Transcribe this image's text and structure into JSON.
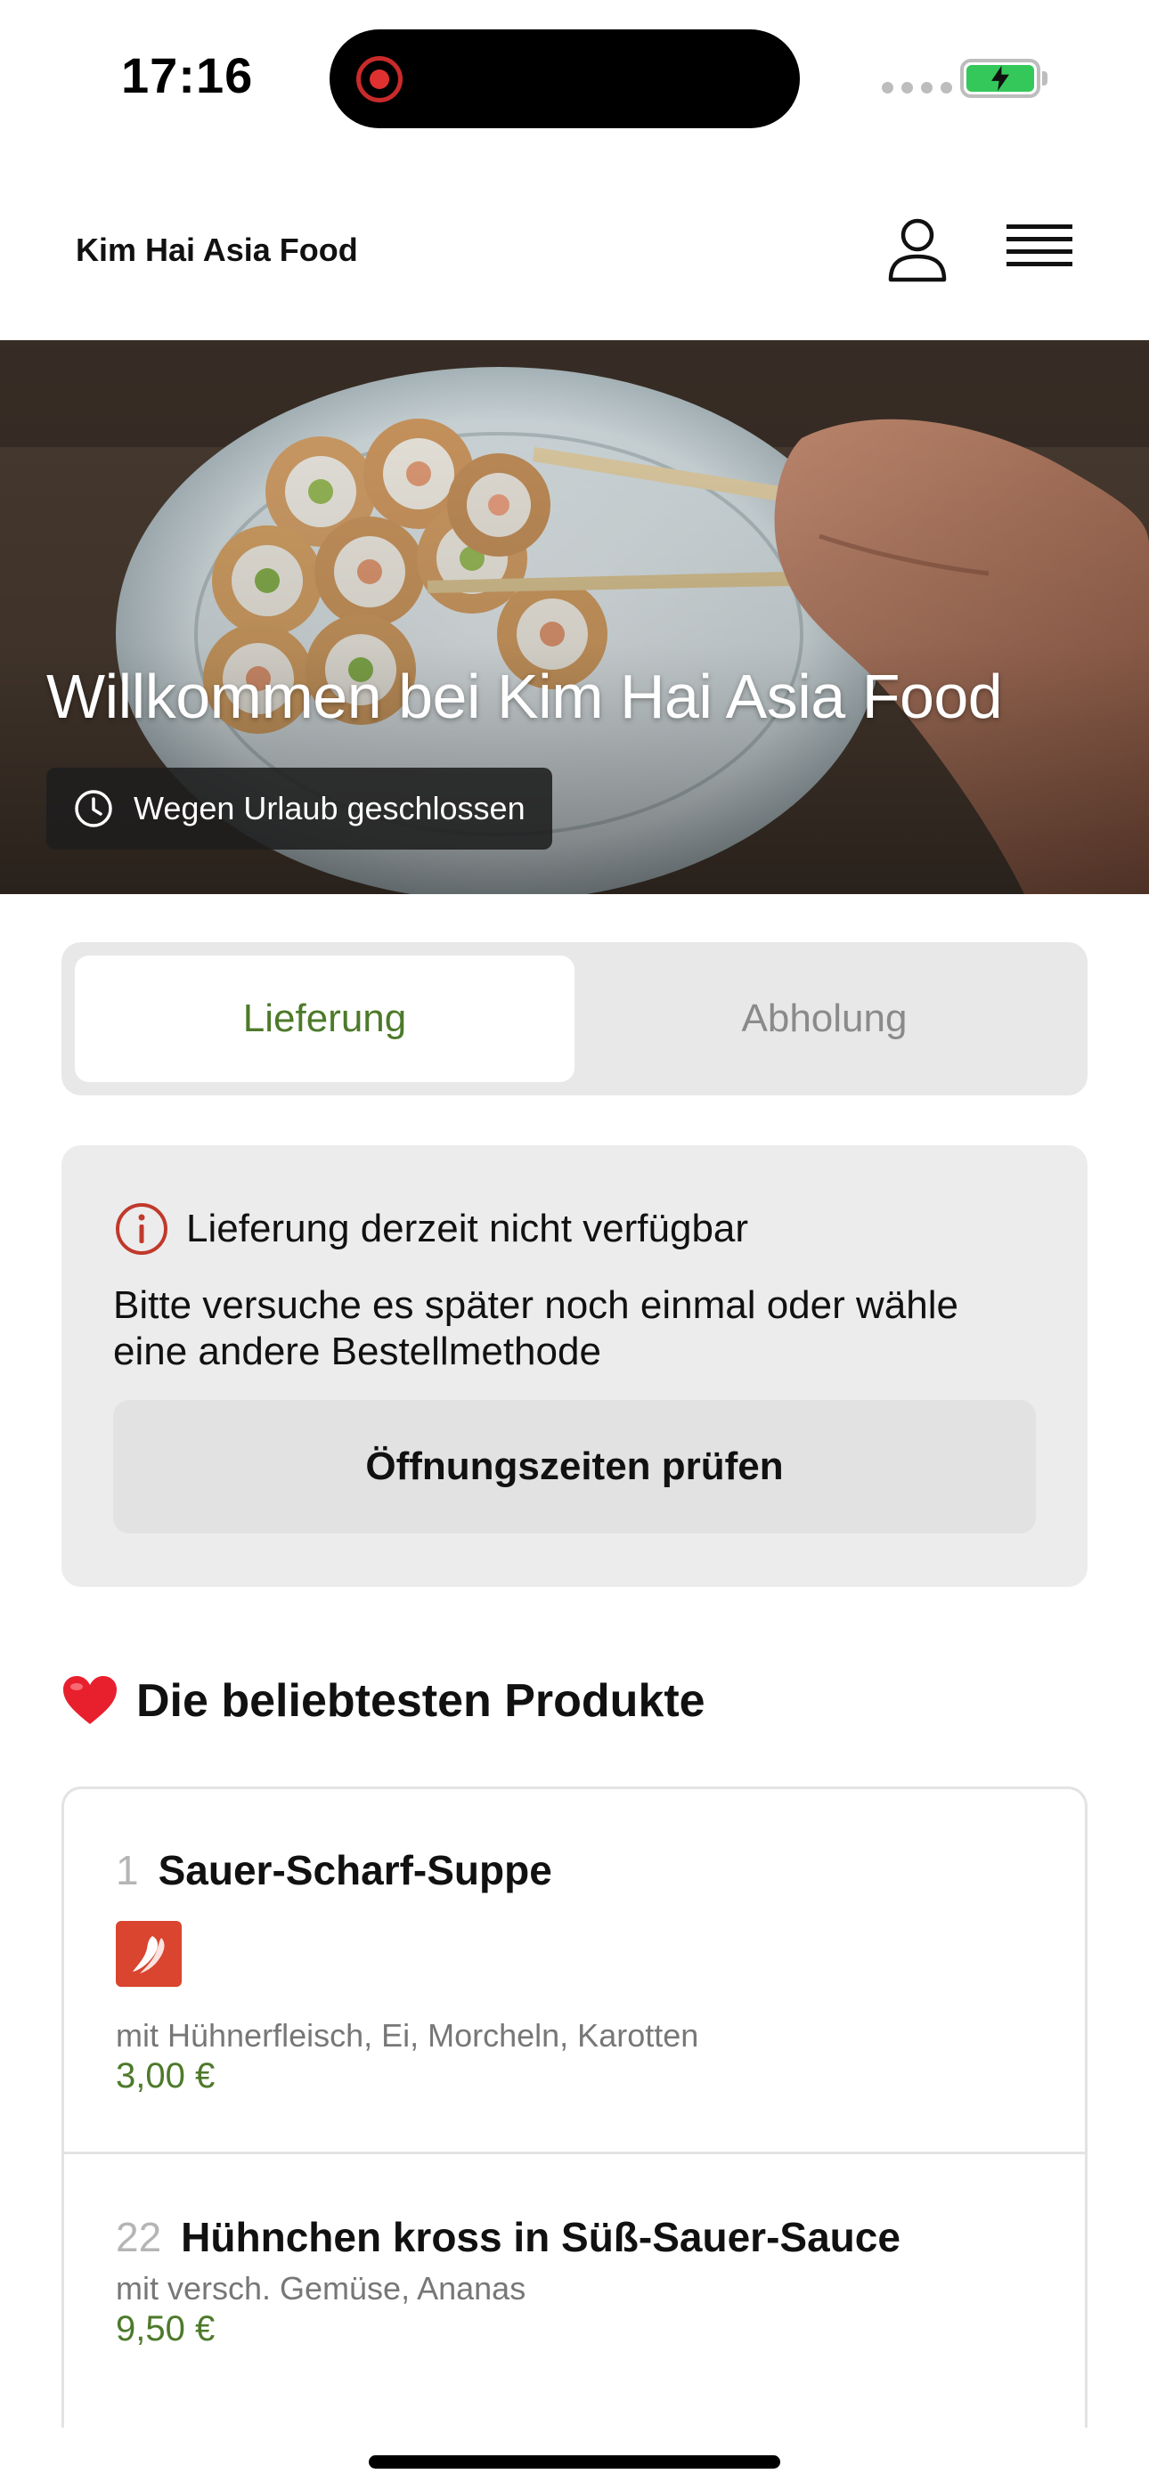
{
  "status_bar": {
    "time": "17:16",
    "battery_color": "#34c759",
    "recording_color": "#e03131"
  },
  "header": {
    "brand": "Kim Hai Asia Food",
    "user_icon": "user-icon",
    "menu_icon": "hamburger-menu-icon"
  },
  "hero": {
    "title": "Willkommen bei Kim Hai Asia Food",
    "status_badge": "Wegen Urlaub geschlossen",
    "status_icon": "clock-icon"
  },
  "order_mode": {
    "options": [
      "Lieferung",
      "Abholung"
    ],
    "selected": "Lieferung",
    "accent_color": "#4d7a2a"
  },
  "notice": {
    "icon": "info-circle-icon",
    "icon_color": "#c0392b",
    "title": "Lieferung derzeit nicht verfügbar",
    "text": "Bitte versuche es später noch einmal oder wähle eine andere Bestellmethode",
    "button_label": "Öffnungszeiten prüfen"
  },
  "popular": {
    "emoji": "❤️",
    "title": "Die beliebtesten Produkte",
    "products": [
      {
        "number": "1",
        "name": "Sauer-Scharf-Suppe",
        "badge_icon": "chili-icon",
        "description": "mit Hühnerfleisch, Ei, Morcheln, Karotten",
        "price": "3,00 €"
      },
      {
        "number": "22",
        "name": "Hühnchen kross in Süß-Sauer-Sauce",
        "description": "mit versch. Gemüse, Ananas",
        "price": "9,50 €"
      }
    ]
  }
}
